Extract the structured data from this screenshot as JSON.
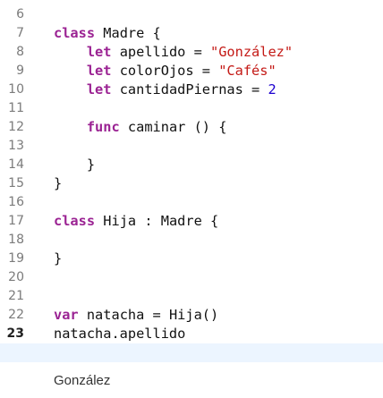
{
  "gutter": {
    "line_numbers": [
      "6",
      "7",
      "8",
      "9",
      "10",
      "11",
      "12",
      "13",
      "14",
      "15",
      "16",
      "17",
      "18",
      "19",
      "20",
      "21",
      "22",
      "23"
    ],
    "active_line": "23"
  },
  "code": {
    "l6": "",
    "l7": {
      "kw": "class",
      "rest": " Madre {"
    },
    "l8": {
      "kw": "let",
      "rest": " apellido = ",
      "str": "\"González\""
    },
    "l9": {
      "kw": "let",
      "rest": " colorOjos = ",
      "str": "\"Cafés\""
    },
    "l10": {
      "kw": "let",
      "rest": " cantidadPiernas = ",
      "num": "2"
    },
    "l11": "",
    "l12": {
      "kw": "func",
      "rest": " caminar () {"
    },
    "l13": "",
    "l14": "}",
    "l15": "}",
    "l16": "",
    "l17": {
      "kw": "class",
      "rest": " Hija : Madre {"
    },
    "l18": "",
    "l19": "}",
    "l20": "",
    "l21": "",
    "l22": {
      "kw": "var",
      "rest": " natacha = Hija()"
    },
    "l23": "natacha.apellido"
  },
  "result": {
    "value": "González"
  },
  "colors": {
    "keyword": "#9b2393",
    "string": "#c41a16",
    "number": "#1c00cf",
    "current_line_bg": "#ecf5ff"
  }
}
